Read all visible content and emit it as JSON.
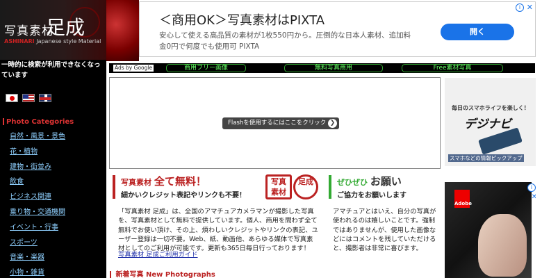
{
  "logo": {
    "kanji": "写真素材",
    "big": "足成",
    "brand": "ASHINARI",
    "tagline": "Japanese style Material"
  },
  "sidebar": {
    "notice": "一時的に検索が利用できなくなっています",
    "category_header": "Photo Categories",
    "categories": [
      "自然・風景・景色",
      "花・植物",
      "建物・街並み",
      "飲食",
      "ビジネス関連",
      "乗り物・交通機関",
      "イベント・行事",
      "スポーツ",
      "音楽・楽器",
      "小物・雑貨"
    ]
  },
  "ad_banner": {
    "title": "＜商用OK＞写真素材はPIXTA",
    "description": "安心して使える高品質の素材が1枚550円から。圧倒的な日本人素材、追加料金0円で何度でも使用可 PIXTA",
    "open_label": "開く",
    "info_icon": "i",
    "close_icon": "✕"
  },
  "ad_links": {
    "ads_by": "Ads by Google",
    "links": [
      "商用フリー画像",
      "無料写真商用",
      "Free素材写真"
    ]
  },
  "flash": {
    "button_label": "Flashを使用するにはここをクリック",
    "arrow": "❯"
  },
  "right_ad1": {
    "headline": "毎日のスマホライフを楽しく！",
    "brand": "デジナビ",
    "bottom": "スマホなどの情報ピックアップ"
  },
  "right_ad2": {
    "adobe_label": "Adobe",
    "info_icon": "i",
    "close_icon": "✕"
  },
  "free_section": {
    "title_prefix": "写真素材",
    "title_emphasis": "全て無料！",
    "subtitle": "細かいクレジット表記やリンクも不要！",
    "seal1": "写真素材",
    "seal2": "足成",
    "body": "「写真素材 足成」は、全国のアマチュアカメラマンが撮影した写真を、写真素材として無料で提供しています。個人、商用を問わず全て無料でお使い頂け、その上、煩わしいクレジットやリンクの表記、ユーザー登録は一切不要。Web、紙、動画他、あらゆる媒体で写真素材としてのご利用が可能です。更新も365日毎日行っております！",
    "link": "写真素材 足成ご利用ガイド"
  },
  "request_section": {
    "title_prefix": "ぜひぜひ",
    "title_emphasis": "お願い",
    "subtitle": "ご協力をお願いします",
    "body": "アマチュアとはいえ、自分の写真が使われるのは嬉しいことです。強制ではありませんが、使用した画像などにはコメントを残していただけると、撮影者は非常に喜びます。"
  },
  "new_photos": {
    "label": "新着写真",
    "label_en": "New Photographs"
  }
}
